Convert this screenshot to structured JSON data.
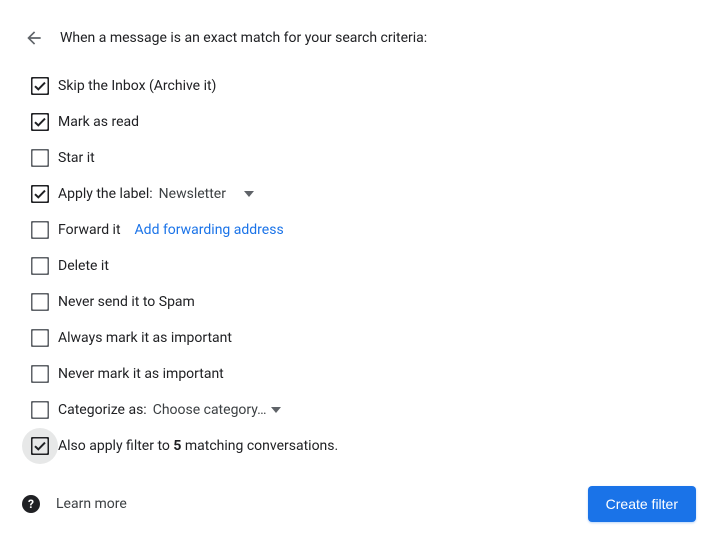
{
  "header": "When a message is an exact match for your search criteria:",
  "options": {
    "skip_inbox": {
      "label": "Skip the Inbox (Archive it)",
      "checked": true
    },
    "mark_read": {
      "label": "Mark as read",
      "checked": true
    },
    "star": {
      "label": "Star it",
      "checked": false
    },
    "apply_label": {
      "label": "Apply the label:",
      "checked": true,
      "select_value": "Newsletter"
    },
    "forward": {
      "label": "Forward it",
      "checked": false,
      "link": "Add forwarding address"
    },
    "delete": {
      "label": "Delete it",
      "checked": false
    },
    "never_spam": {
      "label": "Never send it to Spam",
      "checked": false
    },
    "always_important": {
      "label": "Always mark it as important",
      "checked": false
    },
    "never_important": {
      "label": "Never mark it as important",
      "checked": false
    },
    "categorize": {
      "label": "Categorize as:",
      "checked": false,
      "select_value": "Choose category…"
    },
    "also_apply": {
      "prefix": "Also apply filter to ",
      "count": "5",
      "suffix": " matching conversations.",
      "checked": true,
      "highlighted": true
    }
  },
  "footer": {
    "learn_more": "Learn more",
    "create": "Create filter"
  },
  "colors": {
    "accent": "#1a73e8",
    "text": "#202124",
    "border": "#5f6368"
  }
}
